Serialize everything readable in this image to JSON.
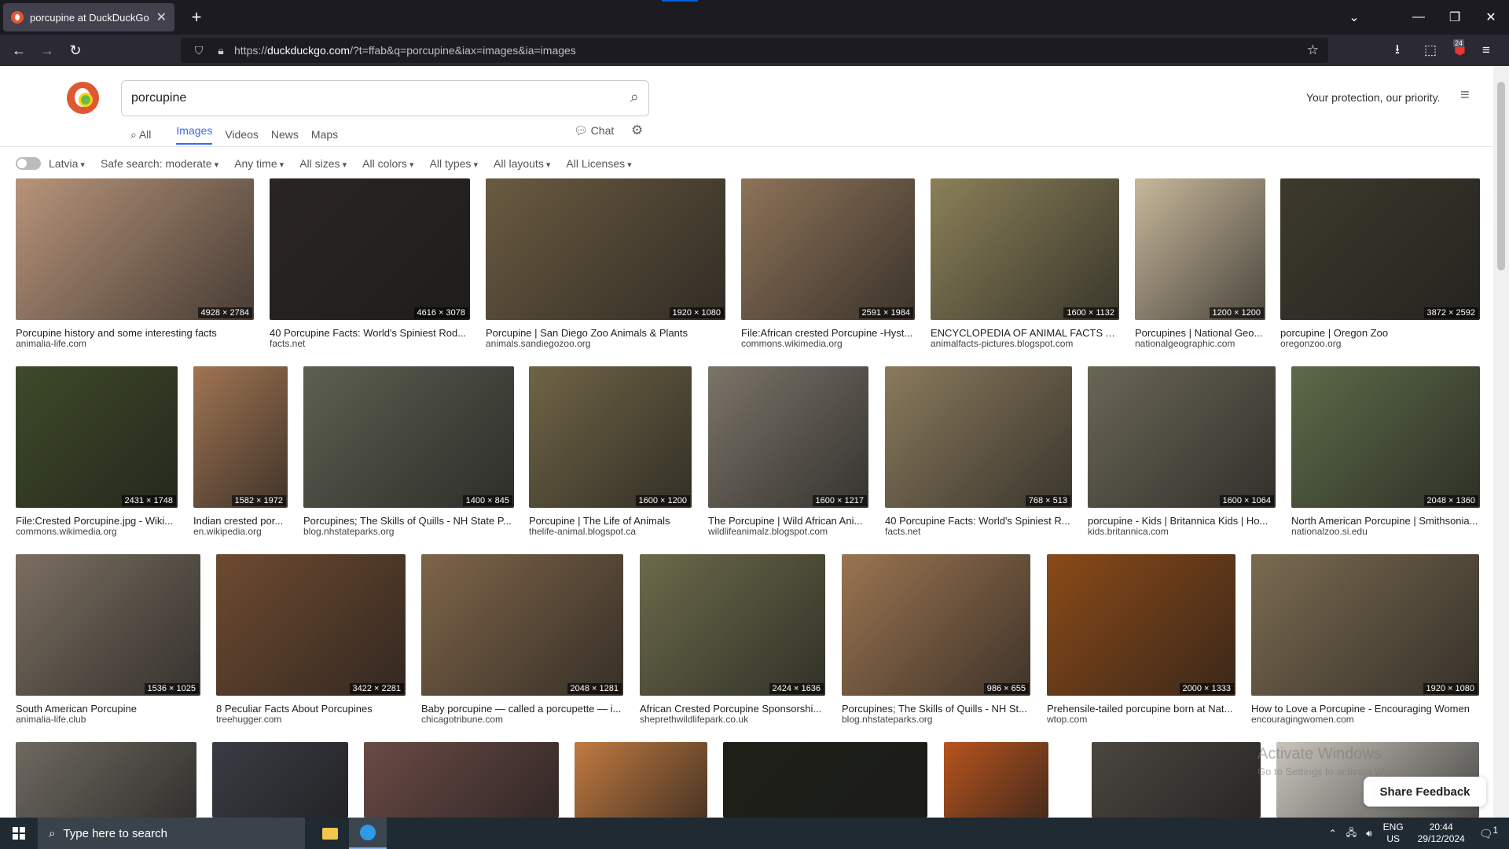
{
  "browser": {
    "tab_title": "porcupine at DuckDuckGo",
    "url_prefix": "https://",
    "url_domain": "duckduckgo.com",
    "url_rest": "/?t=ffab&q=porcupine&iax=images&ia=images",
    "extension_badge": "24"
  },
  "page": {
    "query": "porcupine",
    "protection_text": "Your protection, our priority.",
    "tabs": [
      "All",
      "Images",
      "Videos",
      "News",
      "Maps"
    ],
    "chat_label": "Chat",
    "filters": [
      "Latvia",
      "Safe search: moderate",
      "Any time",
      "All sizes",
      "All colors",
      "All types",
      "All layouts",
      "All Licenses"
    ]
  },
  "results": [
    {
      "title": "Porcupine history and some interesting facts",
      "source": "animalia-life.com",
      "dims": "4928 × 2784",
      "color": "#b79479"
    },
    {
      "title": "40 Porcupine Facts: World's Spiniest Rod...",
      "source": "facts.net",
      "dims": "4616 × 3078",
      "color": "#2a2522"
    },
    {
      "title": "Porcupine | San Diego Zoo Animals & Plants",
      "source": "animals.sandiegozoo.org",
      "dims": "1920 × 1080",
      "color": "#6a5a40"
    },
    {
      "title": "File:African crested Porcupine -Hyst...",
      "source": "commons.wikimedia.org",
      "dims": "2591 × 1984",
      "color": "#8d7358"
    },
    {
      "title": "ENCYCLOPEDIA OF ANIMAL FACTS A...",
      "source": "animalfacts-pictures.blogspot.com",
      "dims": "1600 × 1132",
      "color": "#8a8058"
    },
    {
      "title": "Porcupines | National Geo...",
      "source": "nationalgeographic.com",
      "dims": "1200 × 1200",
      "color": "#c8b89a"
    },
    {
      "title": "porcupine | Oregon Zoo",
      "source": "oregonzoo.org",
      "dims": "3872 × 2592",
      "color": "#3d3a2c"
    },
    {
      "title": "File:Crested Porcupine.jpg - Wiki...",
      "source": "commons.wikimedia.org",
      "dims": "2431 × 1748",
      "color": "#3e4a28"
    },
    {
      "title": "Indian crested por...",
      "source": "en.wikipedia.org",
      "dims": "1582 × 1972",
      "color": "#a07552"
    },
    {
      "title": "Porcupines; The Skills of Quills - NH State P...",
      "source": "blog.nhstateparks.org",
      "dims": "1400 × 845",
      "color": "#5c5f50"
    },
    {
      "title": "Porcupine | The Life of Animals",
      "source": "thelife-animal.blogspot.ca",
      "dims": "1600 × 1200",
      "color": "#6f6445"
    },
    {
      "title": "The Porcupine | Wild African Ani...",
      "source": "wildlifeanimalz.blogspot.com",
      "dims": "1600 × 1217",
      "color": "#7b7468"
    },
    {
      "title": "40 Porcupine Facts: World's Spiniest R...",
      "source": "facts.net",
      "dims": "768 × 513",
      "color": "#8a7a5c"
    },
    {
      "title": "porcupine - Kids | Britannica Kids | Ho...",
      "source": "kids.britannica.com",
      "dims": "1600 × 1064",
      "color": "#6a6656"
    },
    {
      "title": "North American Porcupine | Smithsonia...",
      "source": "nationalzoo.si.edu",
      "dims": "2048 × 1360",
      "color": "#5d6a48"
    },
    {
      "title": "South American Porcupine",
      "source": "animalia-life.club",
      "dims": "1536 × 1025",
      "color": "#7a6e60"
    },
    {
      "title": "8 Peculiar Facts About Porcupines",
      "source": "treehugger.com",
      "dims": "3422 × 2281",
      "color": "#6e4a30"
    },
    {
      "title": "Baby porcupine — called a porcupette — i...",
      "source": "chicagotribune.com",
      "dims": "2048 × 1281",
      "color": "#7e6448"
    },
    {
      "title": "African Crested Porcupine Sponsorshi...",
      "source": "sheprethwildlifepark.co.uk",
      "dims": "2424 × 1636",
      "color": "#6b6a4a"
    },
    {
      "title": "Porcupines; The Skills of Quills - NH St...",
      "source": "blog.nhstateparks.org",
      "dims": "986 × 655",
      "color": "#9a7450"
    },
    {
      "title": "Prehensile-tailed porcupine born at Nat...",
      "source": "wtop.com",
      "dims": "2000 × 1333",
      "color": "#8a4a18"
    },
    {
      "title": "How to Love a Porcupine - Encouraging Women",
      "source": "encouragingwomen.com",
      "dims": "1920 × 1080",
      "color": "#7a6a50"
    }
  ],
  "partial_row_colors": [
    "#6e6a60",
    "#3a3c44",
    "#6a4a44",
    "#c07a40",
    "#1e2018",
    "#b8541e",
    "#4a4640",
    "#c8c4bc"
  ],
  "overlay": {
    "activate_title": "Activate Windows",
    "activate_sub": "Go to Settings to activate Windows.",
    "feedback": "Share Feedback"
  },
  "taskbar": {
    "search_placeholder": "Type here to search",
    "lang1": "ENG",
    "lang2": "US",
    "time": "20:44",
    "date": "29/12/2024",
    "notif": "1"
  }
}
